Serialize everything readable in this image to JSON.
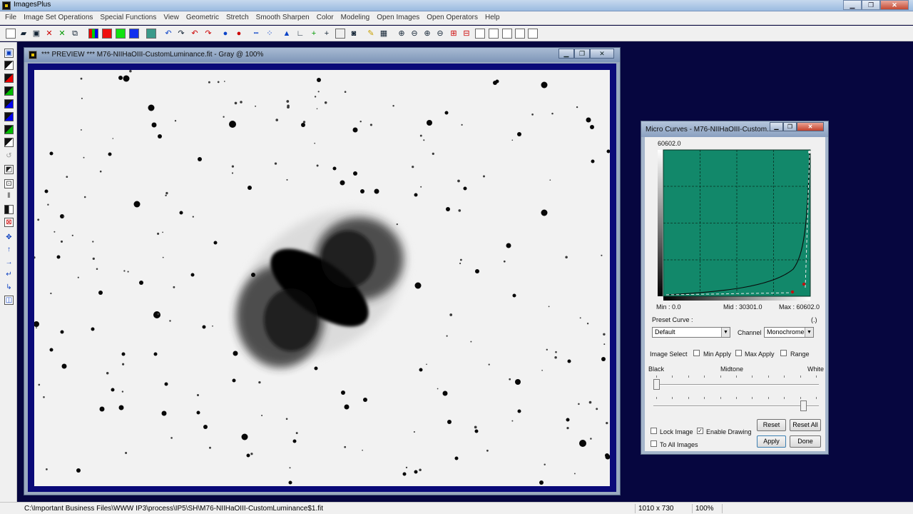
{
  "app": {
    "title": "ImagesPlus"
  },
  "menu": [
    "File",
    "Image Set Operations",
    "Special Functions",
    "View",
    "Geometric",
    "Stretch",
    "Smooth Sharpen",
    "Color",
    "Modeling",
    "Open Images",
    "Open Operators",
    "Help"
  ],
  "preview": {
    "title": "*** PREVIEW *** M76-NIIHaOIII-CustomLuminance.fit - Gray @ 100%"
  },
  "curves": {
    "title": "Micro Curves - M76-NIIHaOIII-Custom...",
    "top_value": "60602.0",
    "min_label": "Min :  0.0",
    "mid_label": "Mid :  30301.0",
    "max_label": "Max :  60602.0",
    "preset_label": "Preset Curve :",
    "preset_extra": "(.)",
    "preset_value": "Default",
    "channel_label": "Channel",
    "channel_value": "Monochrome",
    "image_select_label": "Image Select",
    "min_apply": "Min Apply",
    "max_apply": "Max Apply",
    "range": "Range",
    "black": "Black",
    "midtone": "Midtone",
    "white": "White",
    "lock_image": "Lock Image",
    "enable_drawing": "Enable Drawing",
    "to_all_images": "To All Images",
    "reset": "Reset",
    "reset_all": "Reset All",
    "apply": "Apply",
    "done": "Done",
    "check_mark": "✓",
    "colors": {
      "curve_bg": "#12886a",
      "grid": "#0a2f22",
      "point": "#c01010"
    }
  },
  "status": {
    "path": "C:\\Important Business Files\\WWW IP3\\process\\IP5\\SH\\M76-NIIHaOIII-CustomLuminance$1.fit",
    "dims": "1010 x 730",
    "zoom": "100%"
  }
}
